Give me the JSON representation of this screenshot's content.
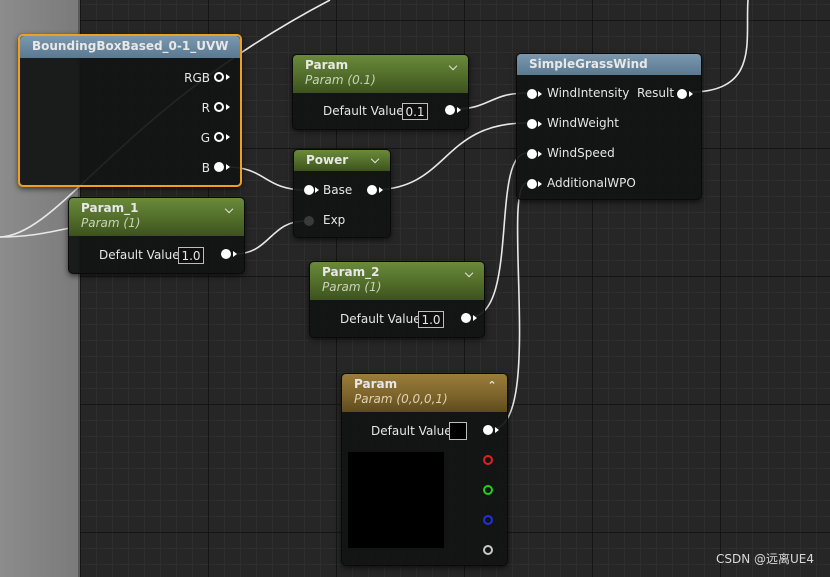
{
  "nodes": {
    "bbox": {
      "title": "BoundingBoxBased_0-1_UVW",
      "outputs": [
        "RGB",
        "R",
        "G",
        "B"
      ]
    },
    "param_top": {
      "title": "Param",
      "subtitle": "Param (0.1)",
      "label": "Default Value",
      "value": "0.1"
    },
    "simple_grass_wind": {
      "title": "SimpleGrassWind",
      "inputs": [
        "WindIntensity",
        "WindWeight",
        "WindSpeed",
        "AdditionalWPO"
      ],
      "output": "Result"
    },
    "power": {
      "title": "Power",
      "inputs": [
        "Base",
        "Exp"
      ]
    },
    "param_1": {
      "title": "Param_1",
      "subtitle": "Param (1)",
      "label": "Default Value",
      "value": "1.0"
    },
    "param_2": {
      "title": "Param_2",
      "subtitle": "Param (1)",
      "label": "Default Value",
      "value": "1.0"
    },
    "param_vec": {
      "title": "Param",
      "subtitle": "Param (0,0,0,1)",
      "label": "Default Value"
    }
  },
  "colors": {
    "selected": "#f0a020",
    "scalar_header": "#4f6a28",
    "function_header": "#5a7a92",
    "vector_header": "#7a622a"
  },
  "icons": {
    "collapse": "chevron-down-icon",
    "expand": "chevron-up-icon"
  },
  "watermark": "CSDN @远离UE4"
}
